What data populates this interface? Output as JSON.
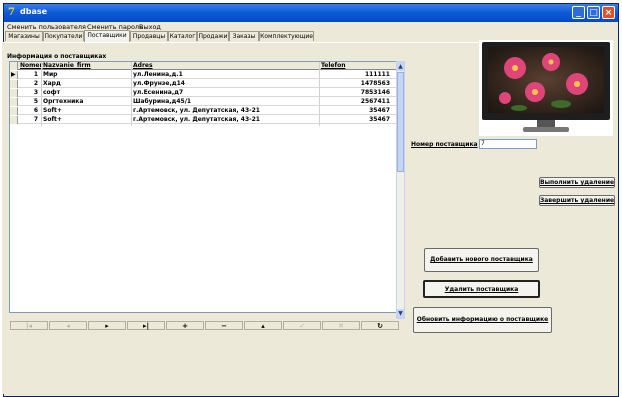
{
  "window": {
    "title": "dbase",
    "controls": {
      "minimize": "_",
      "maximize": "□",
      "close": "×"
    }
  },
  "menu": [
    "Сменить пользователя",
    "Сменить пароль",
    "Выход"
  ],
  "tabs": [
    "Магазины",
    "Покупатели",
    "Поставщики",
    "Продавцы",
    "Каталог",
    "Продажи",
    "Заказы",
    "Комплектующие"
  ],
  "active_tab": "Поставщики",
  "section_title": "Информация о поставщиках",
  "table": {
    "columns": [
      "Nomer",
      "Nazvanie_firm",
      "Adres",
      "Telefon"
    ],
    "rows": [
      [
        "1",
        "Мир",
        "ул.Ленина,д.1",
        "111111"
      ],
      [
        "2",
        "Хард",
        "ул.Фрунзе,д14",
        "1478563"
      ],
      [
        "3",
        "софт",
        "ул.Есенина,д7",
        "7853146"
      ],
      [
        "5",
        "Оргтехника",
        "Шабурина,д45/1",
        "2567411"
      ],
      [
        "6",
        "Soft+",
        "г.Артемовск, ул. Депутатская, 43-21",
        "35467"
      ],
      [
        "7",
        "Soft+",
        "г.Артемовск, ул. Депутатская, 43-21",
        "35467"
      ]
    ]
  },
  "navigator": [
    "|◂",
    "◂",
    "▸",
    "▸|",
    "+",
    "−",
    "▴",
    "✓",
    "✕",
    "↻"
  ],
  "supplier_number": {
    "label": "Номер поставщика",
    "value": "7"
  },
  "buttons": {
    "execute_delete": "Выполнить удаление",
    "finish_delete": "Завершить удаление",
    "add_supplier": "Добавить нового поставщика",
    "delete_supplier": "Удалить поставщика",
    "update_supplier": "Обновить информацию о поставщике"
  },
  "colors": {
    "titlebar": "#0a5ad8",
    "window_bg": "#ece9d8",
    "grid_border": "#7f9db9"
  }
}
